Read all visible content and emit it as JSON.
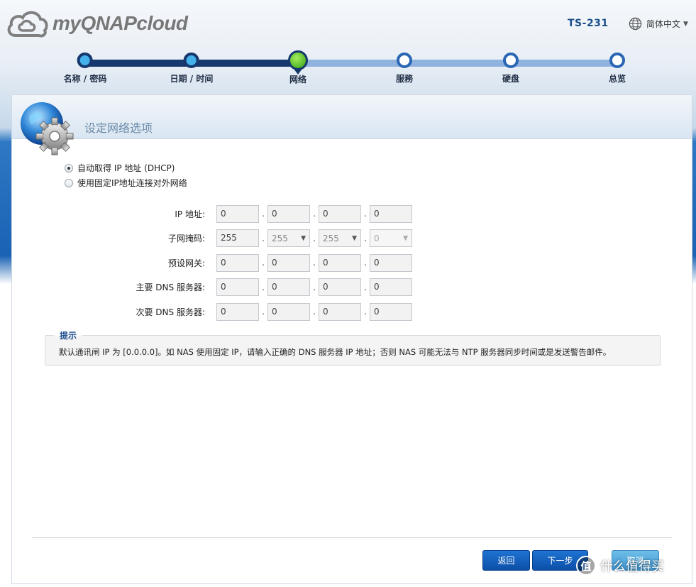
{
  "header": {
    "logo_text": "myQNAPcloud",
    "model": "TS-231",
    "language": "简体中文"
  },
  "stepper": {
    "steps": [
      {
        "label": "名称 / 密码",
        "state": "done"
      },
      {
        "label": "日期 / 时间",
        "state": "done"
      },
      {
        "label": "网络",
        "state": "active"
      },
      {
        "label": "服務",
        "state": "todo"
      },
      {
        "label": "硬盘",
        "state": "todo"
      },
      {
        "label": "总览",
        "state": "todo"
      }
    ]
  },
  "panel": {
    "title": "设定网络选项",
    "options": [
      {
        "label": "自动取得 IP 地址 (DHCP)",
        "selected": true
      },
      {
        "label": "使用固定IP地址连接对外网络",
        "selected": false
      }
    ],
    "fields": [
      {
        "label": "IP 地址:",
        "octets": [
          "0",
          "0",
          "0",
          "0"
        ]
      },
      {
        "label": "子网掩码:",
        "octets": [
          "255",
          "255",
          "255",
          "0"
        ]
      },
      {
        "label": "预设网关:",
        "octets": [
          "0",
          "0",
          "0",
          "0"
        ]
      },
      {
        "label": "主要 DNS 服务器:",
        "octets": [
          "0",
          "0",
          "0",
          "0"
        ]
      },
      {
        "label": "次要 DNS 服务器:",
        "octets": [
          "0",
          "0",
          "0",
          "0"
        ]
      }
    ],
    "hint": {
      "title": "提示",
      "text": "默认通讯闸 IP 为 [0.0.0.0]。如 NAS 使用固定 IP，请输入正确的 DNS 服务器 IP 地址；否则 NAS 可能无法与 NTP 服务器同步时间或是发送警告邮件。"
    },
    "buttons": {
      "back": "返回",
      "next": "下一步",
      "cancel": "取消"
    }
  },
  "watermark": {
    "icon_text": "值",
    "text": "什么值得买"
  },
  "colors": {
    "progress_done": "#16386e",
    "progress_todo": "#8fb3de",
    "active_step": "#3aa51b",
    "button_blue": "#0c4fa8",
    "hint_title": "#1f4f8f"
  }
}
